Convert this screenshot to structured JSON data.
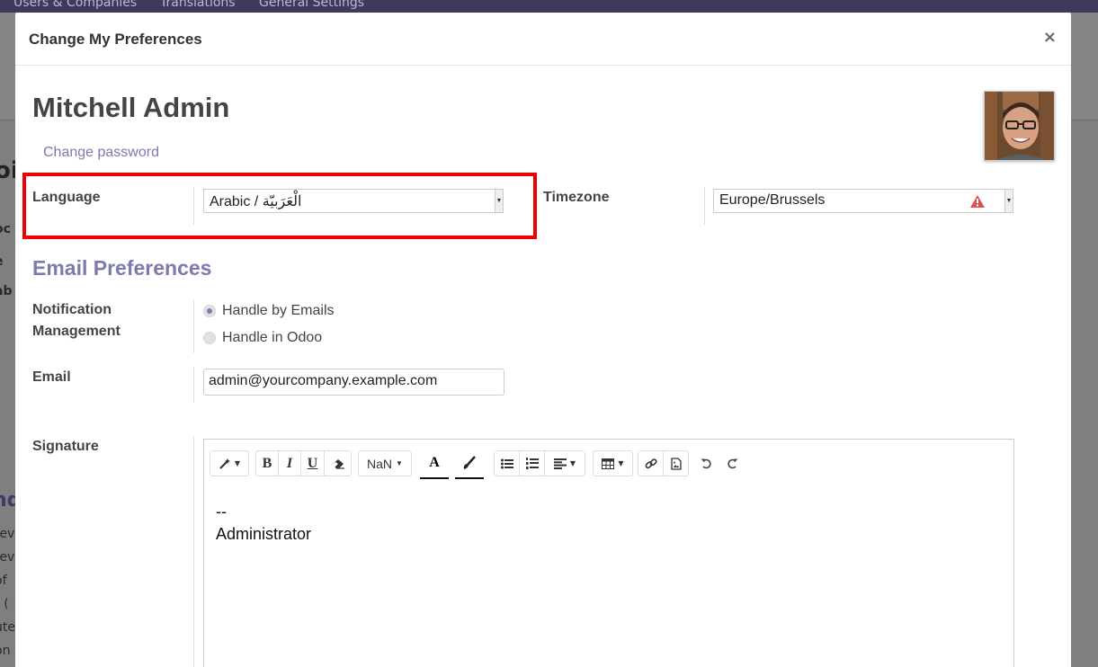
{
  "background": {
    "menu": [
      "Users & Companies",
      "Translations",
      "General Settings"
    ],
    "fragments": [
      "oi",
      "oc",
      "e",
      "ab",
      "nd",
      "rev",
      "rev",
      "of",
      "r (",
      "ute",
      "on"
    ]
  },
  "modal": {
    "title": "Change My Preferences",
    "close_label": "×",
    "user_name": "Mitchell Admin",
    "change_password": "Change password",
    "language": {
      "label": "Language",
      "value": "Arabic / الْعَرَبيّة"
    },
    "timezone": {
      "label": "Timezone",
      "value": "Europe/Brussels",
      "warning_color": "#d9534f"
    },
    "email_prefs": {
      "title": "Email Preferences",
      "notification_label": "Notification Management",
      "notification_label_line1": "Notification",
      "notification_label_line2": "Management",
      "options": [
        {
          "label": "Handle by Emails",
          "checked": true
        },
        {
          "label": "Handle in Odoo",
          "checked": false
        }
      ],
      "email_label": "Email",
      "email_value": "admin@yourcompany.example.com",
      "signature_label": "Signature",
      "signature_lines": [
        "--",
        "Administrator"
      ]
    },
    "editor_toolbar": {
      "style": "",
      "bold": "B",
      "italic": "I",
      "underline": "U",
      "font_size": "NaN",
      "text_color": "A"
    }
  },
  "colors": {
    "accent": "#7c7bad",
    "highlight": "#ee0000",
    "topbar": "#3d3a5e"
  }
}
